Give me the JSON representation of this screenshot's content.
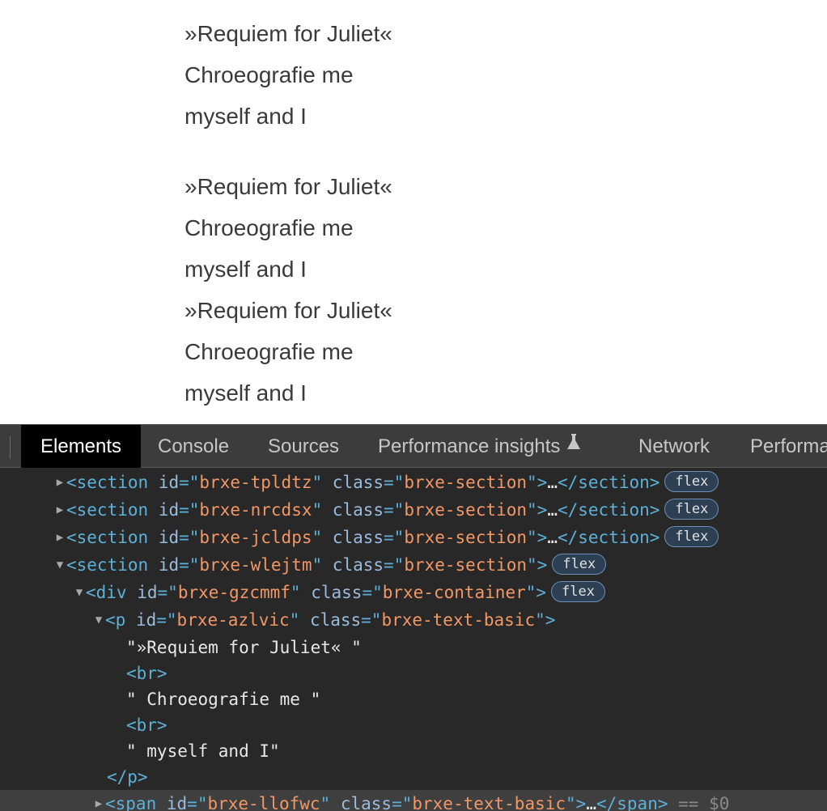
{
  "page": {
    "blocks": [
      {
        "lines": [
          "»Requiem for Juliet«",
          "Chroeografie me",
          "myself and I"
        ]
      },
      {
        "lines": [
          "»Requiem for Juliet«",
          "Chroeografie me",
          "myself and I"
        ]
      },
      {
        "lines": [
          "»Requiem for Juliet«",
          "Chroeografie me",
          "myself and I"
        ]
      }
    ]
  },
  "devtools": {
    "tabs": [
      {
        "label": "Elements",
        "active": true
      },
      {
        "label": "Console"
      },
      {
        "label": "Sources"
      },
      {
        "label": "Performance insights",
        "icon": "flask-icon"
      },
      {
        "label": "Network"
      },
      {
        "label": "Performa"
      }
    ],
    "dom": {
      "sections": [
        {
          "id": "brxe-tpldtz",
          "class": "brxe-section",
          "badge": "flex"
        },
        {
          "id": "brxe-nrcdsx",
          "class": "brxe-section",
          "badge": "flex"
        },
        {
          "id": "brxe-jcldps",
          "class": "brxe-section",
          "badge": "flex"
        },
        {
          "id": "brxe-wlejtm",
          "class": "brxe-section",
          "badge": "flex"
        }
      ],
      "div": {
        "id": "brxe-gzcmmf",
        "class": "brxe-container",
        "badge": "flex"
      },
      "p": {
        "id": "brxe-azlvic",
        "class": "brxe-text-basic"
      },
      "texts": [
        "\"»Requiem for Juliet« \"",
        "\" Chroeografie me \"",
        "\" myself and I\""
      ],
      "br": "<br>",
      "p_close": "</p>",
      "span": {
        "id": "brxe-llofwc",
        "class": "brxe-text-basic",
        "suffix": "== $0"
      },
      "ellipsis": "…"
    }
  }
}
